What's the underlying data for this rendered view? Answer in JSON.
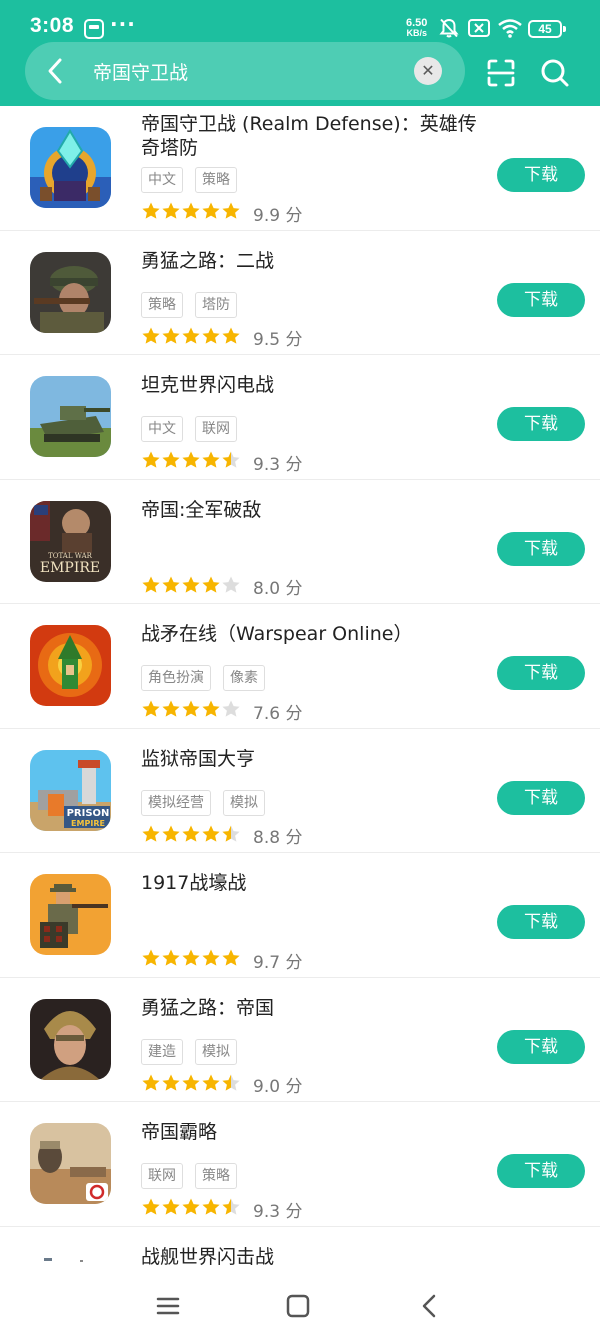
{
  "status": {
    "time": "3:08",
    "speed_value": "6.50",
    "speed_unit": "KB/s",
    "battery": "45"
  },
  "search": {
    "query": "帝国守卫战"
  },
  "colors": {
    "accent": "#1dbf9f",
    "star": "#f7b500",
    "star_empty": "#dddddd"
  },
  "apps": [
    {
      "title": "帝国守卫战 (Realm Defense)：英雄传奇塔防",
      "tags": [
        "中文",
        "策略"
      ],
      "rating": 5,
      "score": "9.9 分",
      "button": "下载",
      "icon": "realm-defense-icon"
    },
    {
      "title": "勇猛之路：二战",
      "tags": [
        "策略",
        "塔防"
      ],
      "rating": 5,
      "score": "9.5 分",
      "button": "下载",
      "icon": "road-to-valor-ww2-icon"
    },
    {
      "title": "坦克世界闪电战",
      "tags": [
        "中文",
        "联网"
      ],
      "rating": 4.5,
      "score": "9.3 分",
      "button": "下载",
      "icon": "world-of-tanks-blitz-icon"
    },
    {
      "title": "帝国:全军破敌",
      "tags": [],
      "rating": 4,
      "score": "8.0 分",
      "button": "下载",
      "icon": "total-war-empire-icon",
      "icon_text_1": "TOTAL WAR",
      "icon_text_2": "EMPIRE"
    },
    {
      "title": "战矛在线（Warspear Online）",
      "tags": [
        "角色扮演",
        "像素"
      ],
      "rating": 4,
      "score": "7.6 分",
      "button": "下载",
      "icon": "warspear-online-icon"
    },
    {
      "title": "监狱帝国大亨",
      "tags": [
        "模拟经营",
        "模拟"
      ],
      "rating": 4.5,
      "score": "8.8 分",
      "button": "下载",
      "icon": "prison-empire-icon",
      "icon_text_1": "PRISON",
      "icon_text_2": "EMPIRE"
    },
    {
      "title": "1917战壕战",
      "tags": [],
      "rating": 5,
      "score": "9.7 分",
      "button": "下载",
      "icon": "1917-trench-war-icon"
    },
    {
      "title": "勇猛之路：帝国",
      "tags": [
        "建造",
        "模拟"
      ],
      "rating": 4.5,
      "score": "9.0 分",
      "button": "下载",
      "icon": "road-to-valor-empires-icon"
    },
    {
      "title": "帝国霸略",
      "tags": [
        "联网",
        "策略"
      ],
      "rating": 4.5,
      "score": "9.3 分",
      "button": "下载",
      "icon": "march-of-empires-icon"
    },
    {
      "title": "战舰世界闪击战",
      "tags": [],
      "rating": 0,
      "score": "",
      "button": "",
      "icon": "world-of-warships-blitz-icon"
    }
  ]
}
